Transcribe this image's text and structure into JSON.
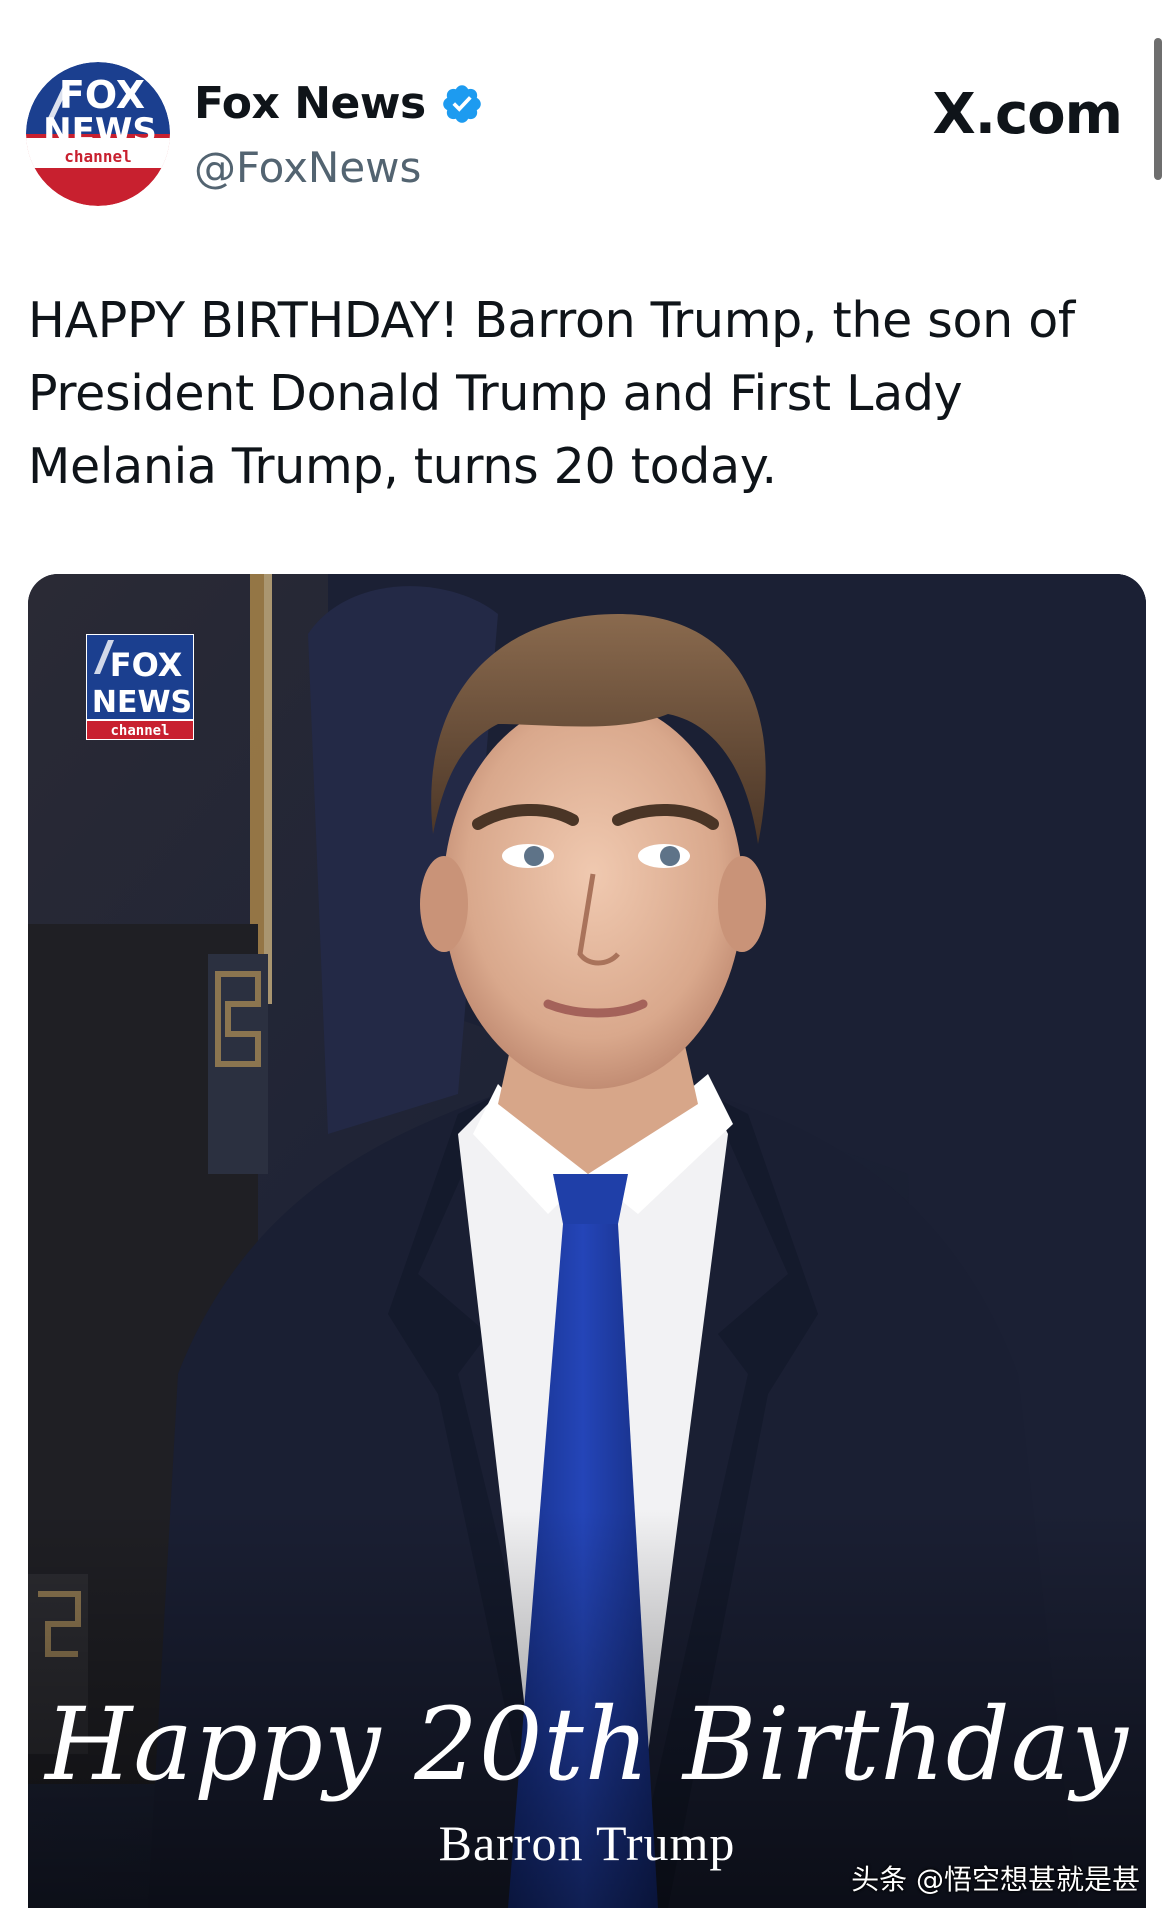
{
  "account": {
    "display_name": "Fox News",
    "handle": "@FoxNews",
    "avatar_text_top": "FOX",
    "avatar_text_mid": "NEWS",
    "avatar_text_bottom": "channel",
    "verified_icon": "verified-badge-icon",
    "verified_color": "#1d9bf0"
  },
  "site": {
    "label": "X.com"
  },
  "tweet": {
    "text": "HAPPY BIRTHDAY! Barron Trump, the son of President Donald Trump and First Lady Melania Trump, turns 20 today."
  },
  "media": {
    "badge_top": "FOX",
    "badge_mid": "NEWS",
    "badge_bottom": "channel",
    "greeting": "Happy 20th Birthday",
    "name": "Barron Trump",
    "watermark": "头条 @悟空想甚就是甚"
  },
  "colors": {
    "fox_blue": "#1b3f8f",
    "fox_red": "#c8202f",
    "suit_navy": "#1a1f33",
    "tie_blue": "#1f3fa8"
  }
}
